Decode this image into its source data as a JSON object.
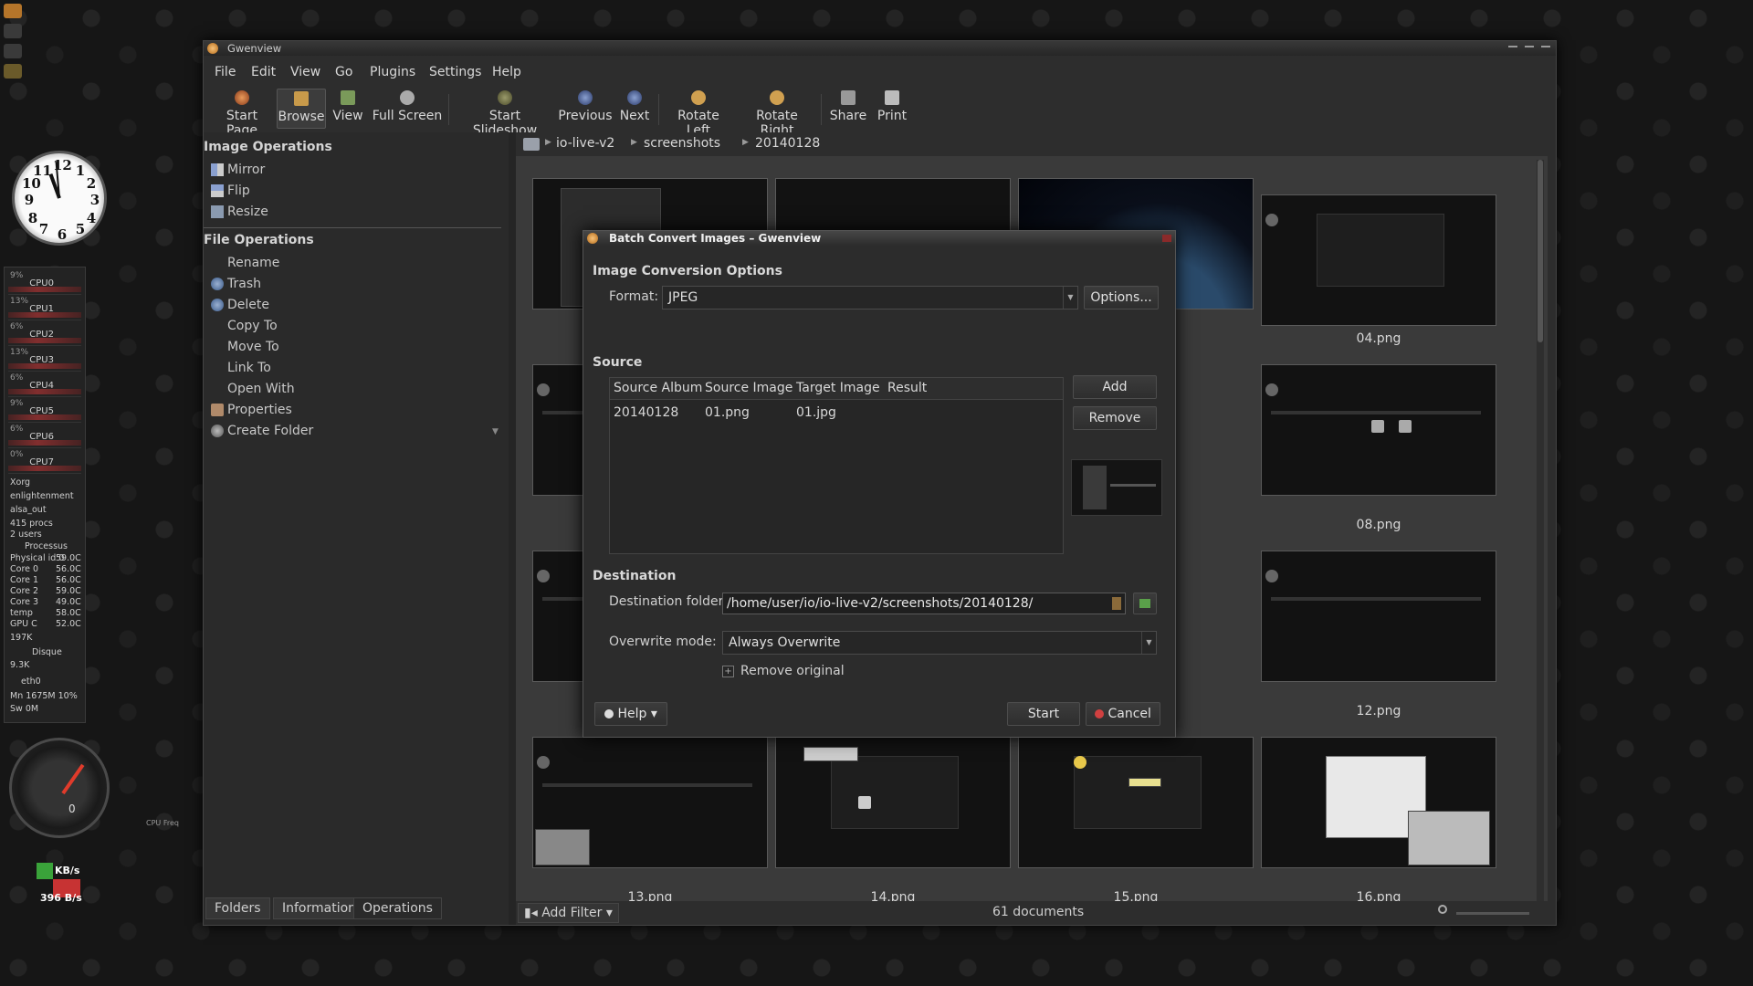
{
  "desktop": {
    "sysmon": {
      "cpus": [
        {
          "label": "CPU0",
          "pct": "9%"
        },
        {
          "label": "CPU1",
          "pct": "13%"
        },
        {
          "label": "CPU2",
          "pct": "6%"
        },
        {
          "label": "CPU3",
          "pct": "13%"
        },
        {
          "label": "CPU4",
          "pct": "6%"
        },
        {
          "label": "CPU5",
          "pct": "9%"
        },
        {
          "label": "CPU6",
          "pct": "6%"
        },
        {
          "label": "CPU7",
          "pct": "0%"
        }
      ],
      "processes": [
        "Xorg",
        "enlightenment",
        "alsa_out"
      ],
      "procs_count": "415 procs",
      "users": "2 users",
      "processus_label": "Processus",
      "temps": [
        {
          "label": "Physical id 0",
          "value": "59.0C"
        },
        {
          "label": "Core 0",
          "value": "56.0C"
        },
        {
          "label": "Core 1",
          "value": "56.0C"
        },
        {
          "label": "Core 2",
          "value": "59.0C"
        },
        {
          "label": "Core 3",
          "value": "49.0C"
        },
        {
          "label": "temp",
          "value": "58.0C"
        },
        {
          "label": "GPU C",
          "value": "52.0C"
        }
      ],
      "disk_small": "197K",
      "disk_label": "Disque",
      "disk_val": "9.3K",
      "net_iface": "eth0",
      "mem": "Mn 1675M 10%",
      "swap": "Sw 0M"
    },
    "gauge": {
      "value": "0",
      "caption": "CPU Freq"
    },
    "net": {
      "up": "KB/s",
      "down": "396 B/s"
    }
  },
  "window": {
    "title": "Gwenview",
    "menu": [
      "File",
      "Edit",
      "View",
      "Go",
      "Plugins",
      "Settings",
      "Help"
    ],
    "toolbar": {
      "start_page": "Start Page",
      "browse": "Browse",
      "view": "View",
      "full_screen": "Full Screen",
      "start_slideshow": "Start Slideshow",
      "previous": "Previous",
      "next": "Next",
      "rotate_left": "Rotate Left",
      "rotate_right": "Rotate Right",
      "share": "Share",
      "print": "Print"
    },
    "sidebar": {
      "image_ops_title": "Image Operations",
      "image_ops": [
        "Mirror",
        "Flip",
        "Resize"
      ],
      "file_ops_title": "File Operations",
      "file_ops": [
        "Rename",
        "Trash",
        "Delete",
        "Copy To",
        "Move To",
        "Link To",
        "Open With",
        "Properties",
        "Create Folder"
      ],
      "tabs": [
        "Folders",
        "Information",
        "Operations"
      ]
    },
    "breadcrumb": [
      "io-live-v2",
      "screenshots",
      "20140128"
    ],
    "thumbs": {
      "t04": "04.png",
      "t08": "08.png",
      "t12": "12.png",
      "t13": "13.png",
      "t14": "14.png",
      "t15": "15.png",
      "t16": "16.png"
    },
    "status": {
      "add_filter": "Add Filter",
      "documents": "61 documents"
    }
  },
  "dialog": {
    "title": "Batch Convert Images – Gwenview",
    "conversion_title": "Image Conversion Options",
    "format_label": "Format:",
    "format_value": "JPEG",
    "options_button": "Options...",
    "source_title": "Source",
    "columns": [
      "Source Album",
      "Source Image",
      "Target Image",
      "Result"
    ],
    "rows": [
      {
        "album": "20140128",
        "source": "01.png",
        "target": "01.jpg",
        "result": ""
      }
    ],
    "add_button": "Add",
    "remove_button": "Remove",
    "destination_title": "Destination",
    "dest_folder_label": "Destination folder:",
    "dest_folder_value": "/home/user/io/io-live-v2/screenshots/20140128/",
    "overwrite_label": "Overwrite mode:",
    "overwrite_value": "Always Overwrite",
    "remove_original_label": "Remove original",
    "help_button": "Help",
    "start_button": "Start",
    "cancel_button": "Cancel"
  },
  "colors": {
    "accent_red": "#c73333",
    "accent_green": "#3aa33a",
    "window_bg": "#2d2d2d"
  }
}
